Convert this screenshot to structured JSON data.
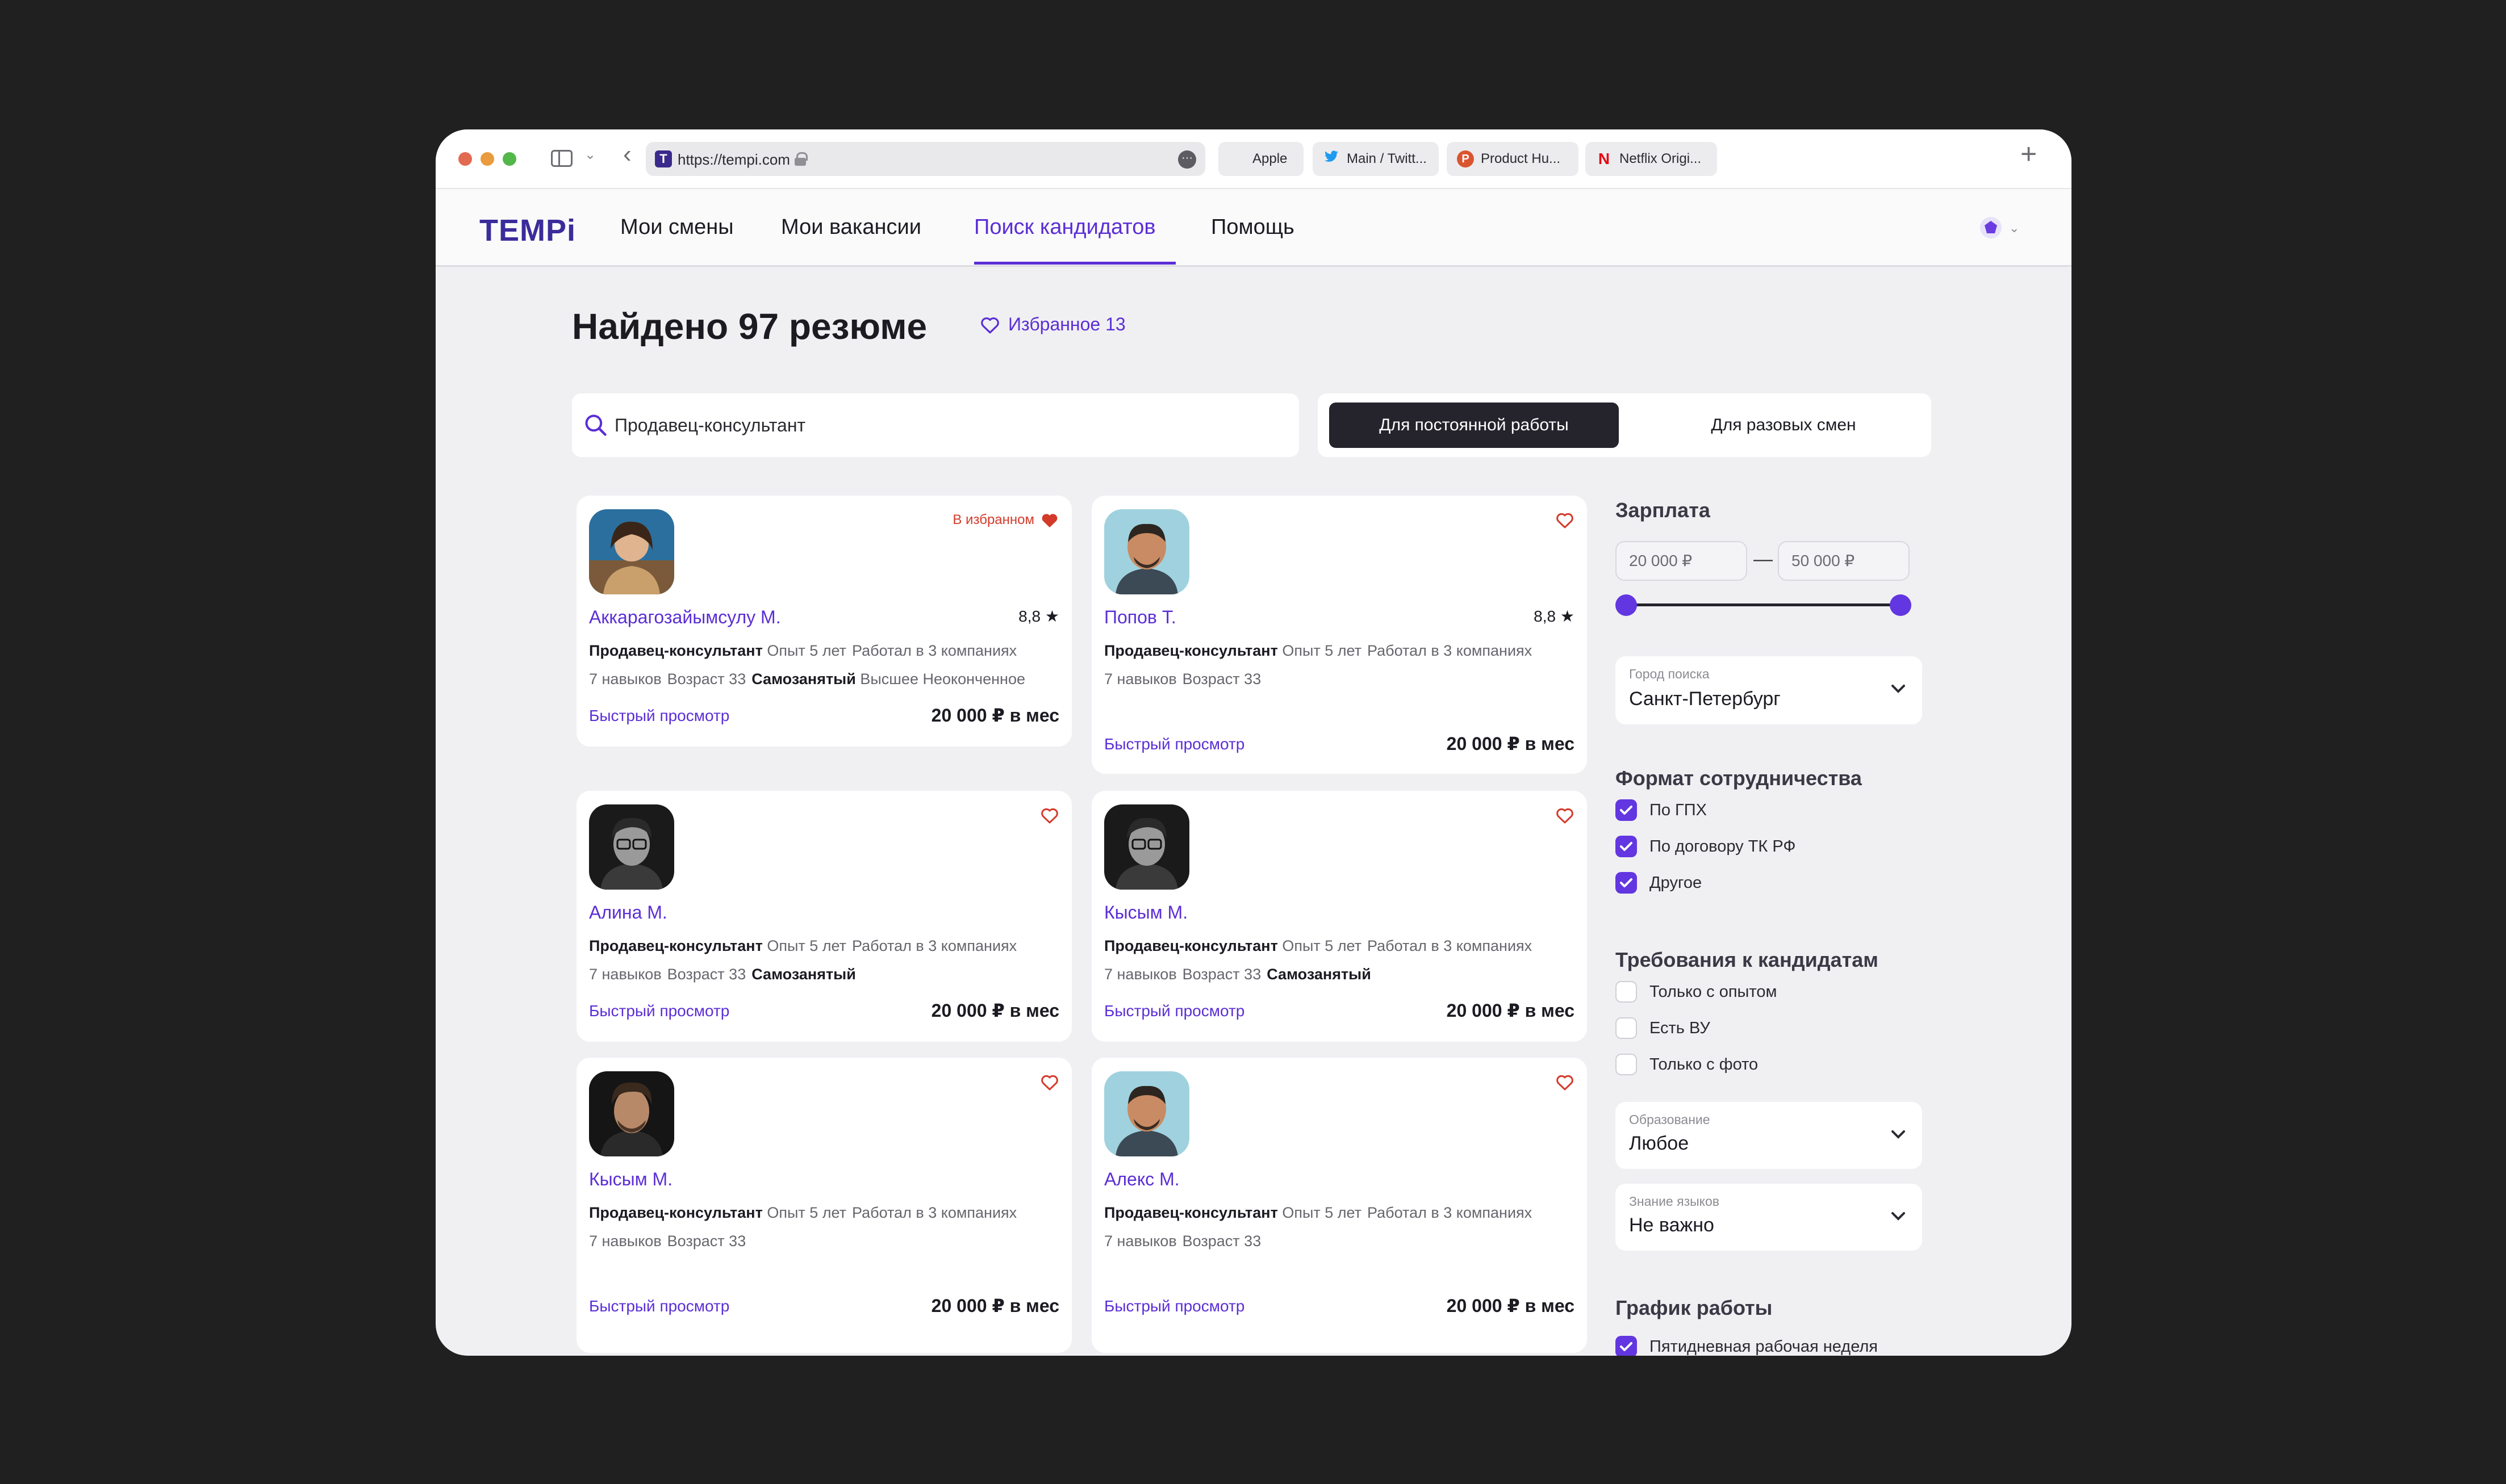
{
  "browser": {
    "url": "https://tempi.com",
    "tabs": [
      {
        "label": "Apple"
      },
      {
        "label": "Main / Twitt..."
      },
      {
        "label": "Product Hu..."
      },
      {
        "label": "Netflix Origi..."
      }
    ]
  },
  "app": {
    "logo": "TEMPi",
    "nav": [
      {
        "label": "Мои смены",
        "active": false
      },
      {
        "label": "Мои вакансии",
        "active": false
      },
      {
        "label": "Поиск кандидатов",
        "active": true
      },
      {
        "label": "Помощь",
        "active": false
      }
    ]
  },
  "page": {
    "title": "Найдено 97 резюме",
    "favorites_link": "Избранное 13",
    "search_value": "Продавец-консультант",
    "segments": {
      "active": "Для постоянной работы",
      "inactive": "Для разовых смен"
    }
  },
  "cards": [
    {
      "name": "Аккарагозайымсулу М.",
      "rating": "8,8",
      "favorite_label": "В избранном",
      "role": "Продавец-консультант",
      "experience": "Опыт 5 лет",
      "companies": "Работал в 3 компаниях",
      "skills": "7 навыков",
      "age": "Возраст 33",
      "status": "Самозанятый",
      "education": "Высшее Неоконченное",
      "quick_view": "Быстрый просмотр",
      "salary": "20 000 ₽ в мес"
    },
    {
      "name": "Попов Т.",
      "rating": "8,8",
      "role": "Продавец-консультант",
      "experience": "Опыт 5 лет",
      "companies": "Работал в 3 компаниях",
      "skills": "7 навыков",
      "age": "Возраст 33",
      "quick_view": "Быстрый просмотр",
      "salary": "20 000 ₽ в мес"
    },
    {
      "name": "Алина М.",
      "role": "Продавец-консультант",
      "experience": "Опыт 5 лет",
      "companies": "Работал в 3 компаниях",
      "skills": "7 навыков",
      "age": "Возраст 33",
      "status": "Самозанятый",
      "quick_view": "Быстрый просмотр",
      "salary": "20 000 ₽ в мес"
    },
    {
      "name": "Кысым М.",
      "role": "Продавец-консультант",
      "experience": "Опыт 5 лет",
      "companies": "Работал в 3 компаниях",
      "skills": "7 навыков",
      "age": "Возраст 33",
      "status": "Самозанятый",
      "quick_view": "Быстрый просмотр",
      "salary": "20 000 ₽ в мес"
    },
    {
      "name": "Кысым М.",
      "role": "Продавец-консультант",
      "experience": "Опыт 5 лет",
      "companies": "Работал в 3 компаниях",
      "skills": "7 навыков",
      "age": "Возраст 33",
      "quick_view": "Быстрый просмотр",
      "salary": "20 000 ₽ в мес"
    },
    {
      "name": "Алекс М.",
      "role": "Продавец-консультант",
      "experience": "Опыт 5 лет",
      "companies": "Работал в 3 компаниях",
      "skills": "7 навыков",
      "age": "Возраст 33",
      "quick_view": "Быстрый просмотр",
      "salary": "20 000 ₽ в мес"
    }
  ],
  "filters": {
    "salary": {
      "title": "Зарплата",
      "min": "20 000 ₽",
      "max": "50 000 ₽"
    },
    "city": {
      "label": "Город поиска",
      "value": "Санкт-Петербург"
    },
    "format": {
      "title": "Формат сотрудничества",
      "options": [
        {
          "label": "По ГПХ",
          "checked": true
        },
        {
          "label": "По договору ТК РФ",
          "checked": true
        },
        {
          "label": "Другое",
          "checked": true
        }
      ]
    },
    "requirements": {
      "title": "Требования к кандидатам",
      "options": [
        {
          "label": "Только с опытом",
          "checked": false
        },
        {
          "label": "Есть ВУ",
          "checked": false
        },
        {
          "label": "Только с фото",
          "checked": false
        }
      ]
    },
    "education": {
      "label": "Образование",
      "value": "Любое"
    },
    "languages": {
      "label": "Знание языков",
      "value": "Не важно"
    },
    "schedule": {
      "title": "График работы",
      "options": [
        {
          "label": "Пятидневная рабочая неделя",
          "checked": true
        }
      ]
    }
  },
  "colors": {
    "accent": "#5b2ed6",
    "favorite": "#d43a2a",
    "dark": "#25232c"
  }
}
